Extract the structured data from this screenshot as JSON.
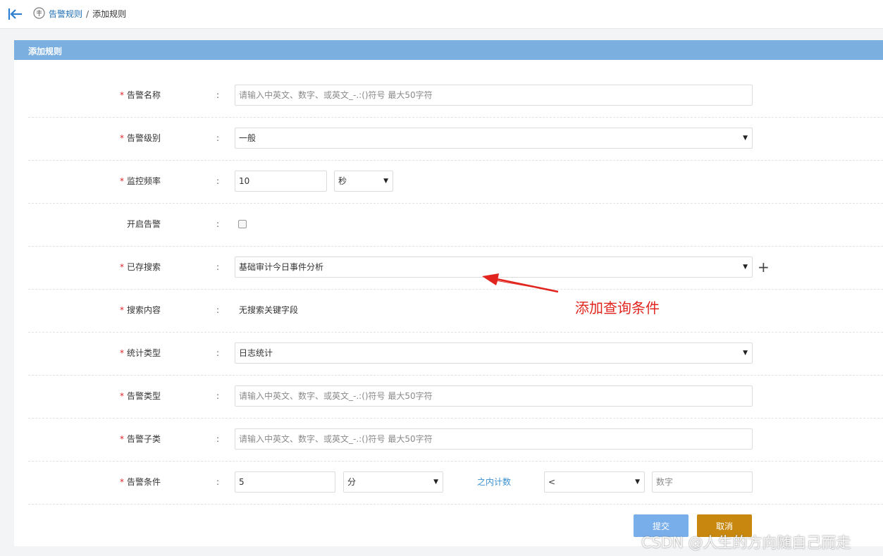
{
  "breadcrumb": {
    "parent": "告警规则",
    "separator": "/",
    "current": "添加规则"
  },
  "panel": {
    "title": "添加规则"
  },
  "form": {
    "required_mark": "*",
    "colon": ":",
    "alert_name": {
      "label": "告警名称",
      "placeholder": "请输入中英文、数字、或英文_-.:()符号   最大50字符",
      "value": ""
    },
    "alert_level": {
      "label": "告警级别",
      "selected": "一般"
    },
    "monitor_freq": {
      "label": "监控频率",
      "value": "10",
      "unit_selected": "秒"
    },
    "enable_alert": {
      "label": "开启告警",
      "checked": false
    },
    "saved_search": {
      "label": "已存搜索",
      "selected": "基础审计今日事件分析"
    },
    "search_content": {
      "label": "搜索内容",
      "value": "无搜索关键字段"
    },
    "stat_type": {
      "label": "统计类型",
      "selected": "日志统计"
    },
    "alert_type": {
      "label": "告警类型",
      "placeholder": "请输入中英文、数字、或英文_-.:()符号   最大50字符",
      "value": ""
    },
    "alert_subtype": {
      "label": "告警子类",
      "placeholder": "请输入中英文、数字、或英文_-.:()符号   最大50字符",
      "value": ""
    },
    "alert_condition": {
      "label": "告警条件",
      "value": "5",
      "unit_selected": "分",
      "within_label": "之内计数",
      "operator_selected": "<",
      "number_placeholder": "数字"
    }
  },
  "buttons": {
    "submit": "提交",
    "cancel": "取消"
  },
  "annotation": {
    "text": "添加查询条件",
    "color": "#e1241d"
  },
  "watermark": "CSDN @人生的方向随自己而走",
  "colors": {
    "header_bar": "#7aafe0",
    "submit_button": "#78aeea",
    "cancel_button": "#c8880f",
    "link": "#1f6fb4",
    "required": "#d9262c"
  },
  "icons": {
    "back": "arrow-left-to-bar-icon",
    "breadcrumb": "circle-list-icon",
    "caret": "caret-down-icon",
    "add": "plus-icon"
  }
}
